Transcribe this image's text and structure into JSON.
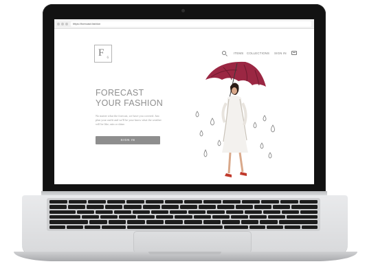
{
  "browser": {
    "url": "https://forecast.fashion"
  },
  "logo": {
    "letter": "F",
    "sub": "6"
  },
  "nav": {
    "items_label": "ITEMS",
    "collections_label": "COLLECTIONS",
    "signin_label": "SIGN IN"
  },
  "hero": {
    "headline_line1": "FORECAST",
    "headline_line2": "YOUR FASHION",
    "body": "No matter what the forecast, we have you covered. Just plan your outfit and we'll be your know what the weather will be like, rain or shine.",
    "cta_label": "SIGN IN"
  },
  "colors": {
    "accent_gray": "#8e8e8e",
    "umbrella": "#9b2743",
    "device_dark": "#121212",
    "device_silver": "#dedfe1"
  },
  "icons": [
    "search-icon",
    "cart-icon",
    "raindrop-icon"
  ]
}
